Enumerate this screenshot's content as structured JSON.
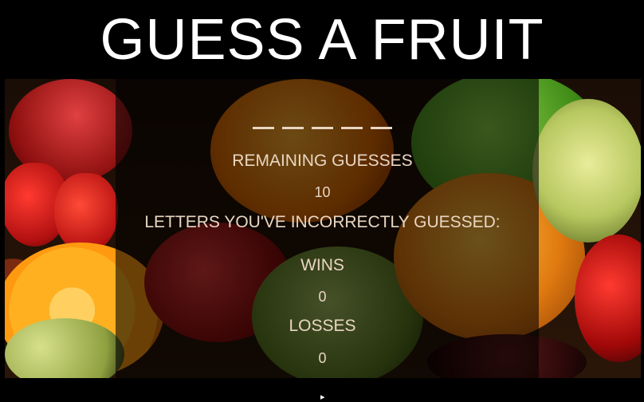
{
  "title": "GUESS A FRUIT",
  "word": {
    "blanks": [
      "_",
      "_",
      "_",
      "_",
      "_"
    ]
  },
  "remaining": {
    "label": "REMAINING GUESSES",
    "value": "10"
  },
  "incorrect": {
    "label": "LETTERS YOU'VE INCORRECTLY GUESSED:",
    "value": ""
  },
  "wins": {
    "label": "WINS",
    "value": "0"
  },
  "losses": {
    "label": "LOSSES",
    "value": "0"
  },
  "colors": {
    "text": "#e9d6c2",
    "title": "#ffffff",
    "background": "#000000"
  }
}
